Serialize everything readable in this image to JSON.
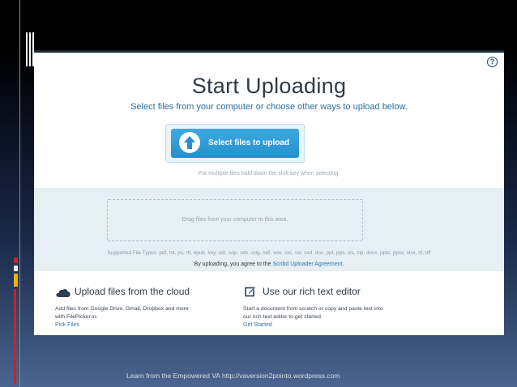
{
  "upload_page": {
    "title": "Start Uploading",
    "subtitle": "Select files from your computer or choose other ways to upload below.",
    "upload_button_label": "Select files to upload",
    "multi_hint": "For multiple files hold down the shift key when selecting.",
    "drop_zone_text": "Drag files from your computer to this area.",
    "supported_types": "Supported File Types: pdf, txt, ps, rtf, epub, key, odt, odp, ods, odg, odf, sxw, sxc, sxi, sxd, doc, ppt, pps, xls, zip, docx, pptx, ppsx, xlsx, tif, tiff",
    "agreement_prefix": "By uploading, you agree to the ",
    "agreement_link": "Scribd Uploader Agreement",
    "agreement_suffix": ".",
    "help_icon": "?",
    "cloud": {
      "icon": "cloud-icon",
      "title": "Upload files from the cloud",
      "description_line1": "Add files from Google Drive, Gmail, Dropbox and more",
      "description_line2": "with FilePicker.io.",
      "link": "Pick Files"
    },
    "editor": {
      "icon": "edit-icon",
      "title": "Use our rich text editor",
      "description_line1": "Start a document from scratch or copy and paste text into",
      "description_line2": "our rich text editor to get started.",
      "link": "Get Started"
    }
  },
  "slide": {
    "footer": "Learn from the Empowered VA  http://vaversion2pointo.wordpress.com"
  },
  "colors": {
    "accent_blue": "#2690cf",
    "link_blue": "#2b78b0",
    "deco_red": "#c0272d",
    "deco_yellow": "#f0b400"
  }
}
